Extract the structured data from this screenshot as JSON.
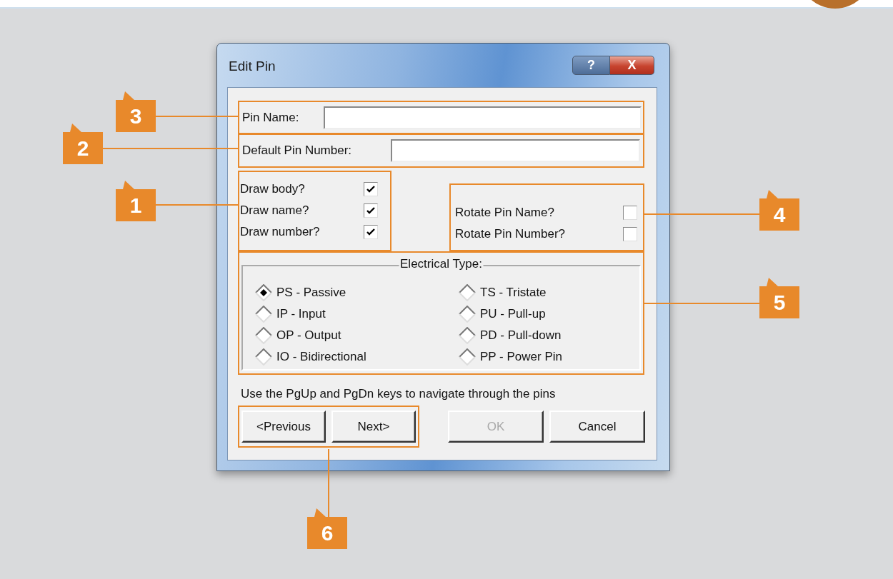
{
  "dialog": {
    "title": "Edit Pin",
    "title_buttons": [
      {
        "kind": "help",
        "glyph": "?"
      },
      {
        "kind": "close",
        "glyph": "X"
      }
    ],
    "pin_name_field": {
      "label": "Pin Name:",
      "callout": "3"
    },
    "pin_number_field": {
      "label": "Default Pin Number:",
      "callout": "2"
    },
    "draw_options": {
      "callout": "1",
      "items": [
        {
          "label": "Draw body?",
          "checked": true
        },
        {
          "label": "Draw name?",
          "checked": true
        },
        {
          "label": "Draw number?",
          "checked": true
        }
      ]
    },
    "rotate_options": {
      "callout": "4",
      "items": [
        {
          "label": "Rotate Pin Name?",
          "checked": false
        },
        {
          "label": "Rotate Pin Number?",
          "checked": false
        }
      ]
    },
    "electrical_type": {
      "label": "Electrical Type:",
      "callout": "5",
      "options": [
        {
          "label": "PS - Passive",
          "selected": true
        },
        {
          "label": "IP - Input",
          "selected": false
        },
        {
          "label": "OP - Output",
          "selected": false
        },
        {
          "label": "IO - Bidirectional",
          "selected": false
        },
        {
          "label": "TS - Tristate",
          "selected": false
        },
        {
          "label": "PU - Pull-up",
          "selected": false
        },
        {
          "label": "PD - Pull-down",
          "selected": false
        },
        {
          "label": "PP - Power Pin",
          "selected": false
        }
      ]
    },
    "hint": "Use the PgUp and PgDn keys to navigate through the pins",
    "navigation": {
      "callout": "6",
      "buttons": [
        {
          "label": "<Previous",
          "disabled": false
        },
        {
          "label": "Next>",
          "disabled": false
        }
      ]
    },
    "buttons": [
      {
        "label": "OK",
        "disabled": true
      },
      {
        "label": "Cancel",
        "disabled": false
      }
    ]
  }
}
